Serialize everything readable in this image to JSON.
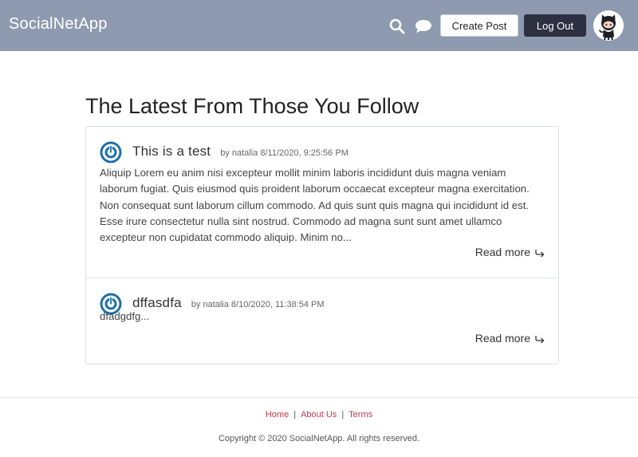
{
  "header": {
    "brand": "SocialNetApp",
    "search_icon": "search-icon",
    "chat_icon": "chat-icon",
    "create_post_label": "Create Post",
    "logout_label": "Log Out",
    "avatar_icon": "octocat-avatar",
    "background_color": "#8d9aaf"
  },
  "main": {
    "title": "The Latest From Those You Follow",
    "posts": [
      {
        "title": "This is a test",
        "meta": "by natalia 8/11/2020, 9:25:56 PM",
        "body": "Aliquip Lorem eu anim nisi excepteur mollit minim laboris incididunt duis magna veniam laborum fugiat. Quis eiusmod quis proident laborum occaecat excepteur magna exercitation. Non consequat sunt laborum cillum commodo. Ad quis sunt quis magna qui incididunt id est. Esse irure consectetur nulla sint nostrud. Commodo ad magna sunt sunt amet ullamco excepteur non cupidatat commodo aliquip. Minim no...",
        "read_more": "Read more",
        "icon": "power-icon"
      },
      {
        "title": "dffasdfa",
        "meta": "by natalia 8/10/2020, 11:38:54 PM",
        "body": "dfadgdfg...",
        "read_more": "Read more",
        "icon": "power-icon"
      }
    ]
  },
  "footer": {
    "links": [
      "Home",
      "About Us",
      "Terms"
    ],
    "separator": "|",
    "copyright": "Copyright © 2020 SocialNetApp. All rights reserved.",
    "link_color": "#c0394a"
  }
}
